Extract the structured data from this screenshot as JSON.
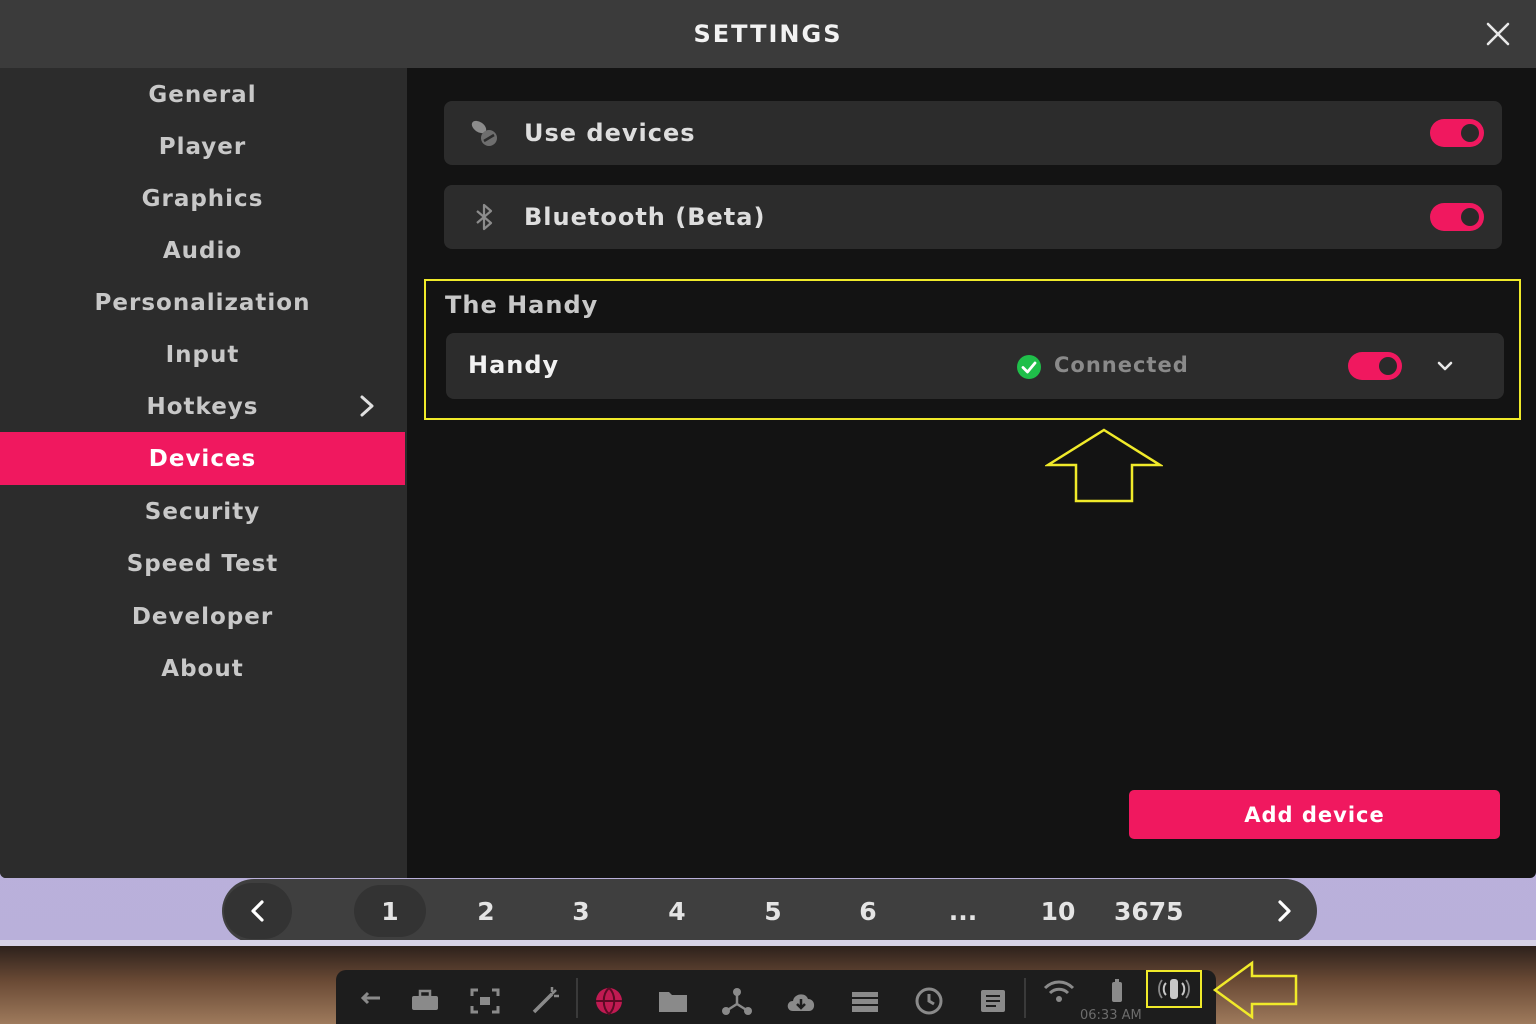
{
  "window": {
    "title": "SETTINGS"
  },
  "sidebar": {
    "items": [
      {
        "label": "General"
      },
      {
        "label": "Player"
      },
      {
        "label": "Graphics"
      },
      {
        "label": "Audio"
      },
      {
        "label": "Personalization"
      },
      {
        "label": "Input"
      },
      {
        "label": "Hotkeys",
        "has_submenu": true
      },
      {
        "label": "Devices",
        "active": true
      },
      {
        "label": "Security"
      },
      {
        "label": "Speed Test"
      },
      {
        "label": "Developer"
      },
      {
        "label": "About"
      }
    ]
  },
  "devices": {
    "use_devices": {
      "label": "Use devices",
      "enabled": true
    },
    "bluetooth": {
      "label": "Bluetooth (Beta)",
      "enabled": true
    },
    "group": {
      "title": "The Handy",
      "device": {
        "name": "Handy",
        "status": "Connected",
        "enabled": true
      }
    },
    "add_button": "Add device"
  },
  "pagination": {
    "pages": [
      "1",
      "2",
      "3",
      "4",
      "5",
      "6",
      "...",
      "10",
      "3675"
    ],
    "current": "1"
  },
  "taskbar": {
    "clock": "06:33 AM"
  },
  "colors": {
    "accent": "#f0185f",
    "highlight": "#f0ea2a",
    "status_ok": "#1fbf4a",
    "panel": "#2c2c2c",
    "background": "#131313"
  }
}
